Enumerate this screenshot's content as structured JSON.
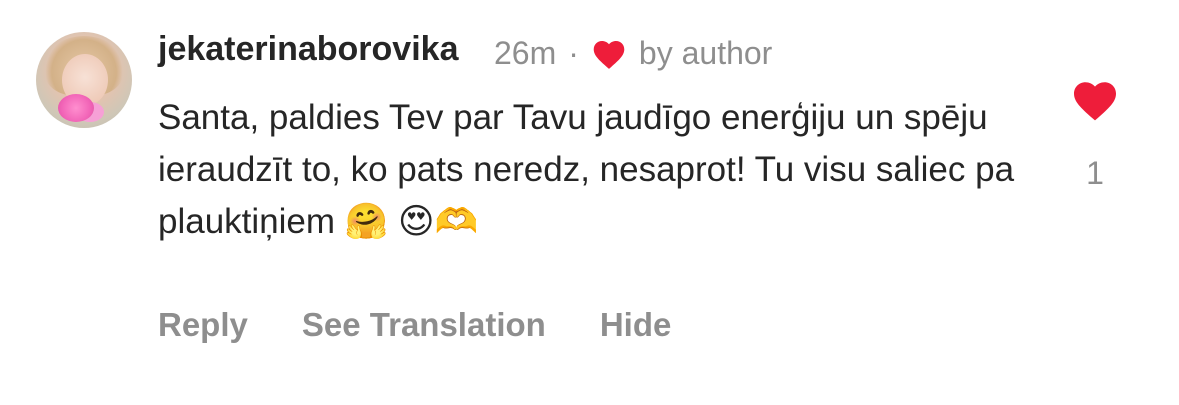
{
  "comment": {
    "username": "jekaterinaborovika",
    "timestamp": "26m",
    "separator": "·",
    "liked_by_author_label": "by author",
    "text": "Santa, paldies Tev par Tavu jaudīgo enerģiju un spēju ieraudzīt to, ko pats neredz, nesaprot! Tu visu saliec pa plauktiņiem 🤗 😍🫶",
    "like_count": "1"
  },
  "actions": {
    "reply": "Reply",
    "see_translation": "See Translation",
    "hide": "Hide"
  },
  "icons": {
    "like_heart": "heart-filled-icon",
    "author_heart": "heart-filled-icon",
    "avatar": "user-avatar"
  },
  "colors": {
    "heart": "#ee1d3a",
    "username": "#262626",
    "meta": "#8e8e8e",
    "action_text": "#8e8e8e"
  }
}
